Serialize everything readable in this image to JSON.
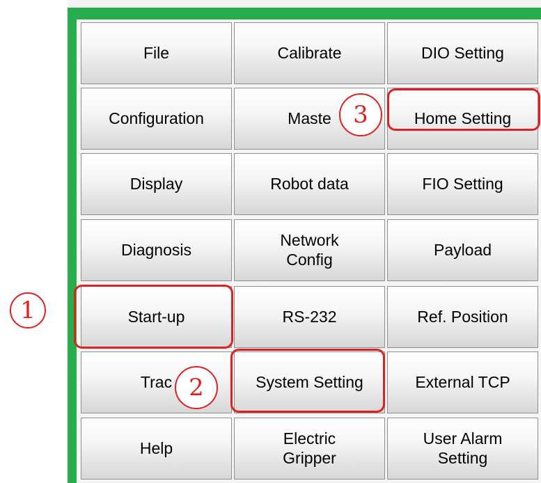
{
  "menu": {
    "buttons": [
      {
        "label": "File"
      },
      {
        "label": "Calibrate"
      },
      {
        "label": "DIO Setting"
      },
      {
        "label": "Configuration"
      },
      {
        "label": "Maste"
      },
      {
        "label": "Home Setting"
      },
      {
        "label": "Display"
      },
      {
        "label": "Robot data"
      },
      {
        "label": "FIO Setting"
      },
      {
        "label": "Diagnosis"
      },
      {
        "label": "Network\nConfig"
      },
      {
        "label": "Payload"
      },
      {
        "label": "Start-up"
      },
      {
        "label": "RS-232"
      },
      {
        "label": "Ref. Position"
      },
      {
        "label": "Trac"
      },
      {
        "label": "System Setting"
      },
      {
        "label": "External TCP"
      },
      {
        "label": "Help"
      },
      {
        "label": "Electric\nGripper"
      },
      {
        "label": "User Alarm\nSetting"
      }
    ]
  },
  "annotations": {
    "step1": "1",
    "step2": "2",
    "step3": "3"
  },
  "colors": {
    "frame": "#27ad4b",
    "highlight": "#e02020"
  }
}
